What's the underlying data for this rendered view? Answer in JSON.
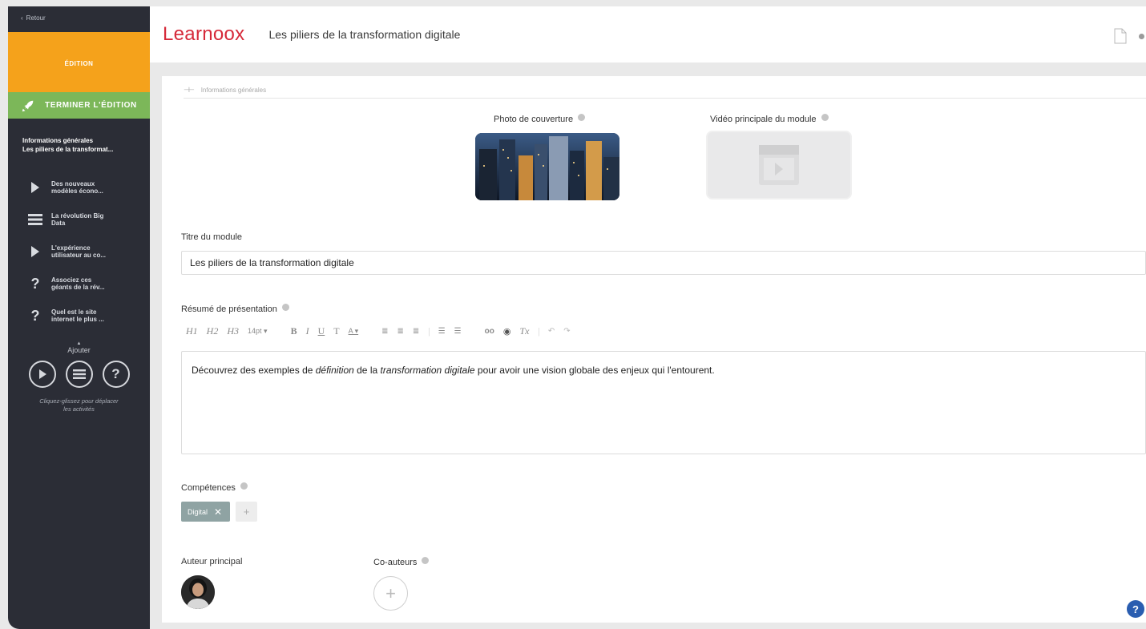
{
  "sidebar": {
    "back_label": "Retour",
    "mode_label": "ÉDITION",
    "finish_label": "TERMINER L'ÉDITION",
    "selected": {
      "title": "Informations générales",
      "subtitle": "Les piliers de la transformat..."
    },
    "activities": [
      {
        "icon": "play-icon",
        "label_1": "Des nouveaux",
        "label_2": "modèles écono..."
      },
      {
        "icon": "list-icon",
        "label_1": "La révolution Big",
        "label_2": "Data"
      },
      {
        "icon": "play-icon",
        "label_1": "L'expérience",
        "label_2": "utilisateur au co..."
      },
      {
        "icon": "question-icon",
        "label_1": "Associez ces",
        "label_2": "géants de la rév..."
      },
      {
        "icon": "question-icon",
        "label_1": "Quel est le site",
        "label_2": "internet le plus ..."
      }
    ],
    "add_label": "Ajouter",
    "hint_line_1": "Cliquez-glissez pour déplacer",
    "hint_line_2": "les activités"
  },
  "header": {
    "logo": "Learnoox",
    "title": "Les piliers de la transformation digitale"
  },
  "main": {
    "section_title": "Informations générales",
    "cover_label": "Photo de couverture",
    "video_label": "Vidéo principale du module",
    "title_label": "Titre du module",
    "title_value": "Les piliers de la transformation digitale",
    "summary_label": "Résumé de présentation",
    "toolbar": {
      "h1": "H1",
      "h2": "H2",
      "h3": "H3",
      "size": "14pt ▾",
      "bold": "B",
      "italic": "I",
      "underline": "U",
      "text": "T",
      "color": "A ▾",
      "link": "oo",
      "clear": "Tx"
    },
    "summary": {
      "p1": "Découvrez des exemples de ",
      "em1": "définition",
      "p2": " de la ",
      "em2": "transformation digitale",
      "p3": " pour avoir une vision globale des enjeux qui l'entourent."
    },
    "skills_label": "Compétences",
    "skills": [
      "Digital"
    ],
    "author_label": "Auteur principal",
    "coauthors_label": "Co-auteurs"
  },
  "colors": {
    "sidebar_bg": "#2b2d36",
    "edition_orange": "#f5a21b",
    "finish_green": "#7cb759",
    "logo_red": "#d62a3a",
    "tag_bg": "#8fa3a3",
    "help_blue": "#2a5db0"
  }
}
